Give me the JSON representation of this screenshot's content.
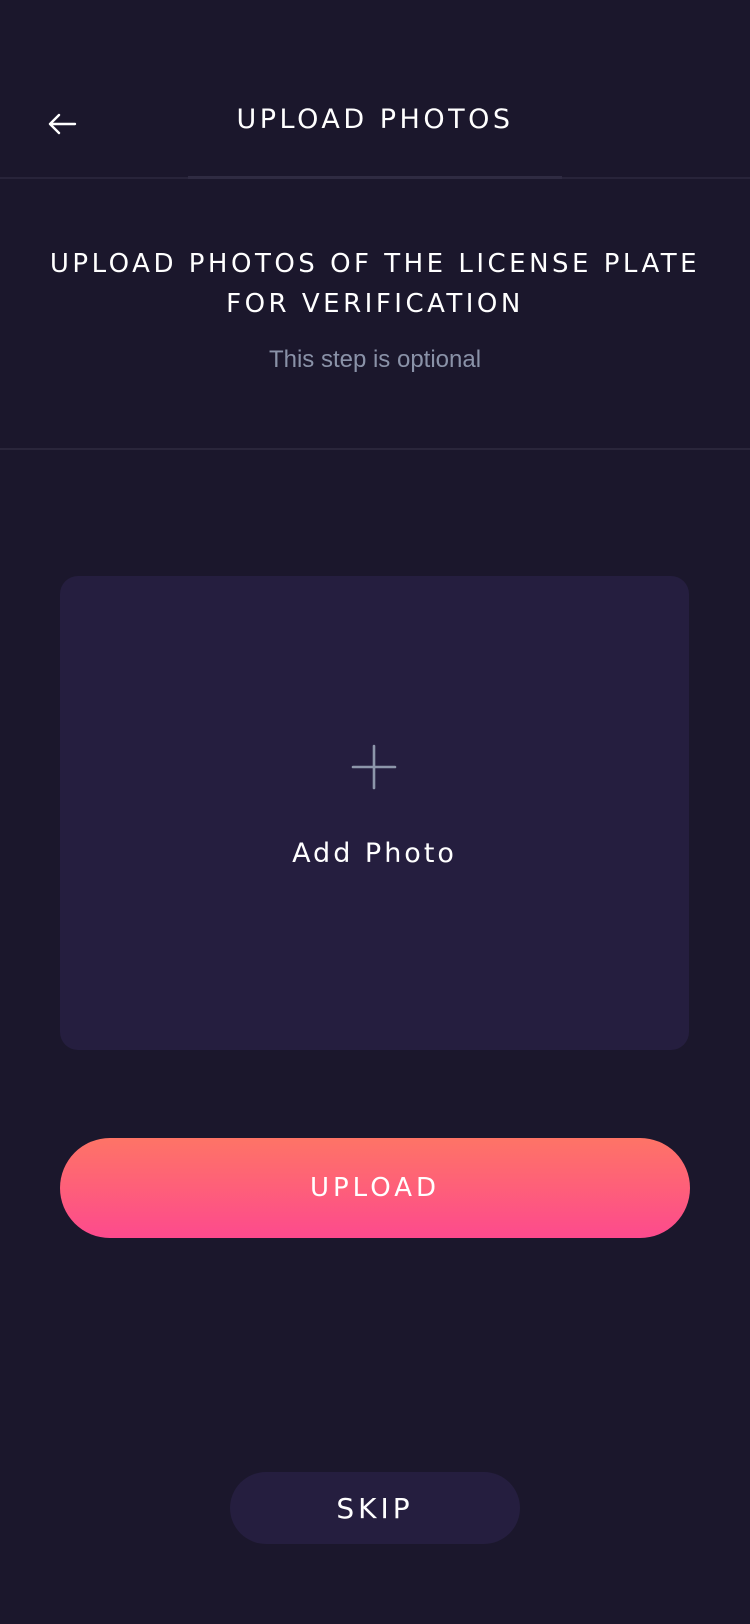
{
  "header": {
    "title": "UPLOAD PHOTOS",
    "back_icon": "arrow-left-icon"
  },
  "instructions": {
    "title": "UPLOAD PHOTOS OF THE LICENSE PLATE FOR VERIFICATION",
    "subtitle": "This step is optional"
  },
  "photo_card": {
    "icon": "plus-icon",
    "label": "Add Photo"
  },
  "actions": {
    "upload_label": "UPLOAD",
    "skip_label": "SKIP"
  },
  "colors": {
    "background": "#1b172c",
    "card": "#251e3f",
    "upload_gradient_top": "#fe7466",
    "upload_gradient_bottom": "#fd4a8d",
    "muted_text": "#8a92a8"
  }
}
